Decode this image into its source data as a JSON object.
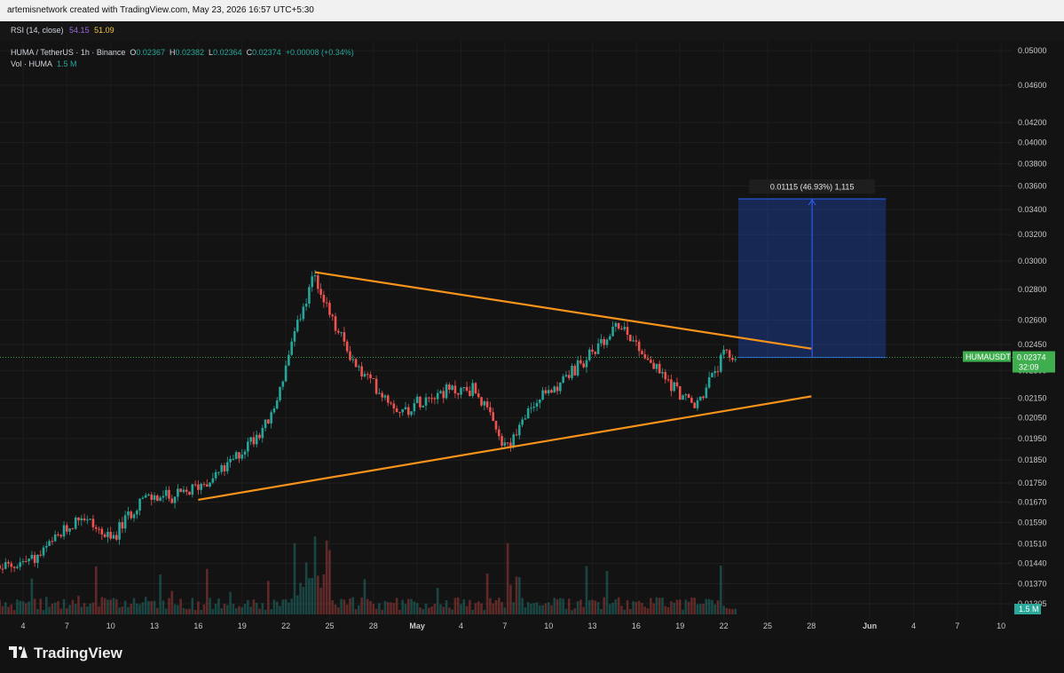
{
  "header": {
    "credit": "artemisnetwork created with TradingView.com, May 23, 2026 16:57 UTC+5:30"
  },
  "rsi": {
    "label": "RSI (14, close)",
    "value1": "54.15",
    "value2": "51.09"
  },
  "legend": {
    "symbol": "HUMA / TetherUS · 1h · Binance",
    "o_label": "O",
    "o_value": "0.02367",
    "h_label": "H",
    "h_value": "0.02382",
    "l_label": "L",
    "l_value": "0.02364",
    "c_label": "C",
    "c_value": "0.02374",
    "change": "+0.00008 (+0.34%)",
    "vol_label": "Vol · HUMA",
    "vol_value": "1.5 M"
  },
  "price_scale": [
    "0.05000",
    "0.04600",
    "0.04200",
    "0.04000",
    "0.03800",
    "0.03600",
    "0.03400",
    "0.03200",
    "0.03000",
    "0.02800",
    "0.02600",
    "0.02450",
    "0.02300",
    "0.02150",
    "0.02050",
    "0.01950",
    "0.01850",
    "0.01750",
    "0.01670",
    "0.01590",
    "0.01510",
    "0.01440",
    "0.01370",
    "0.01305"
  ],
  "time_scale": [
    "4",
    "7",
    "10",
    "13",
    "16",
    "19",
    "22",
    "25",
    "28",
    "May",
    "4",
    "7",
    "10",
    "13",
    "16",
    "19",
    "22",
    "25",
    "28",
    "Jun",
    "4",
    "7",
    "10"
  ],
  "current_price": {
    "symbol": "HUMAUSDT",
    "price": "0.02374",
    "countdown": "32:09"
  },
  "volume_badge": "1.5 M",
  "measure": {
    "label": "0.01115 (46.93%) 1,115"
  },
  "colors": {
    "trendline": "#f7931a",
    "up": "#26a69a",
    "down": "#ef5350",
    "measure": "#2962ff",
    "price_tag": "#3fae4f"
  },
  "brand": "TradingView",
  "chart_data": {
    "type": "candlestick",
    "symbol": "HUMA / TetherUS",
    "interval": "1h",
    "y_scale": "log",
    "ylim": [
      0.0128,
      0.051
    ],
    "x_ticks": [
      "4",
      "7",
      "10",
      "13",
      "16",
      "19",
      "22",
      "25",
      "28",
      "May",
      "4",
      "7",
      "10",
      "13",
      "16",
      "19",
      "22",
      "25",
      "28",
      "Jun",
      "4",
      "7",
      "10"
    ],
    "close_path": [
      {
        "x": "Apr 1",
        "y": 0.014
      },
      {
        "x": "Apr 5",
        "y": 0.0146
      },
      {
        "x": "Apr 8",
        "y": 0.0162
      },
      {
        "x": "Apr 10",
        "y": 0.0152
      },
      {
        "x": "Apr 12",
        "y": 0.0168
      },
      {
        "x": "Apr 15",
        "y": 0.017
      },
      {
        "x": "Apr 18",
        "y": 0.0182
      },
      {
        "x": "Apr 21",
        "y": 0.0205
      },
      {
        "x": "Apr 23",
        "y": 0.0262
      },
      {
        "x": "Apr 24",
        "y": 0.029
      },
      {
        "x": "Apr 25",
        "y": 0.0262
      },
      {
        "x": "Apr 27",
        "y": 0.023
      },
      {
        "x": "Apr 30",
        "y": 0.0208
      },
      {
        "x": "May 2",
        "y": 0.0218
      },
      {
        "x": "May 5",
        "y": 0.022
      },
      {
        "x": "May 7",
        "y": 0.019
      },
      {
        "x": "May 9",
        "y": 0.0212
      },
      {
        "x": "May 12",
        "y": 0.0232
      },
      {
        "x": "May 15",
        "y": 0.0258
      },
      {
        "x": "May 17",
        "y": 0.0234
      },
      {
        "x": "May 20",
        "y": 0.021
      },
      {
        "x": "May 22",
        "y": 0.0238
      },
      {
        "x": "May 23",
        "y": 0.0237
      }
    ],
    "trendlines": [
      {
        "name": "upper",
        "from": {
          "x": "Apr 24",
          "y": 0.0292
        },
        "to": {
          "x": "May 28",
          "y": 0.02425
        }
      },
      {
        "name": "lower",
        "from": {
          "x": "Apr 16",
          "y": 0.0168
        },
        "to": {
          "x": "May 28",
          "y": 0.0216
        }
      }
    ],
    "measure": {
      "from": 0.02374,
      "to": 0.03489,
      "change": 0.01115,
      "percent": 46.93,
      "ticks": 1115
    }
  }
}
